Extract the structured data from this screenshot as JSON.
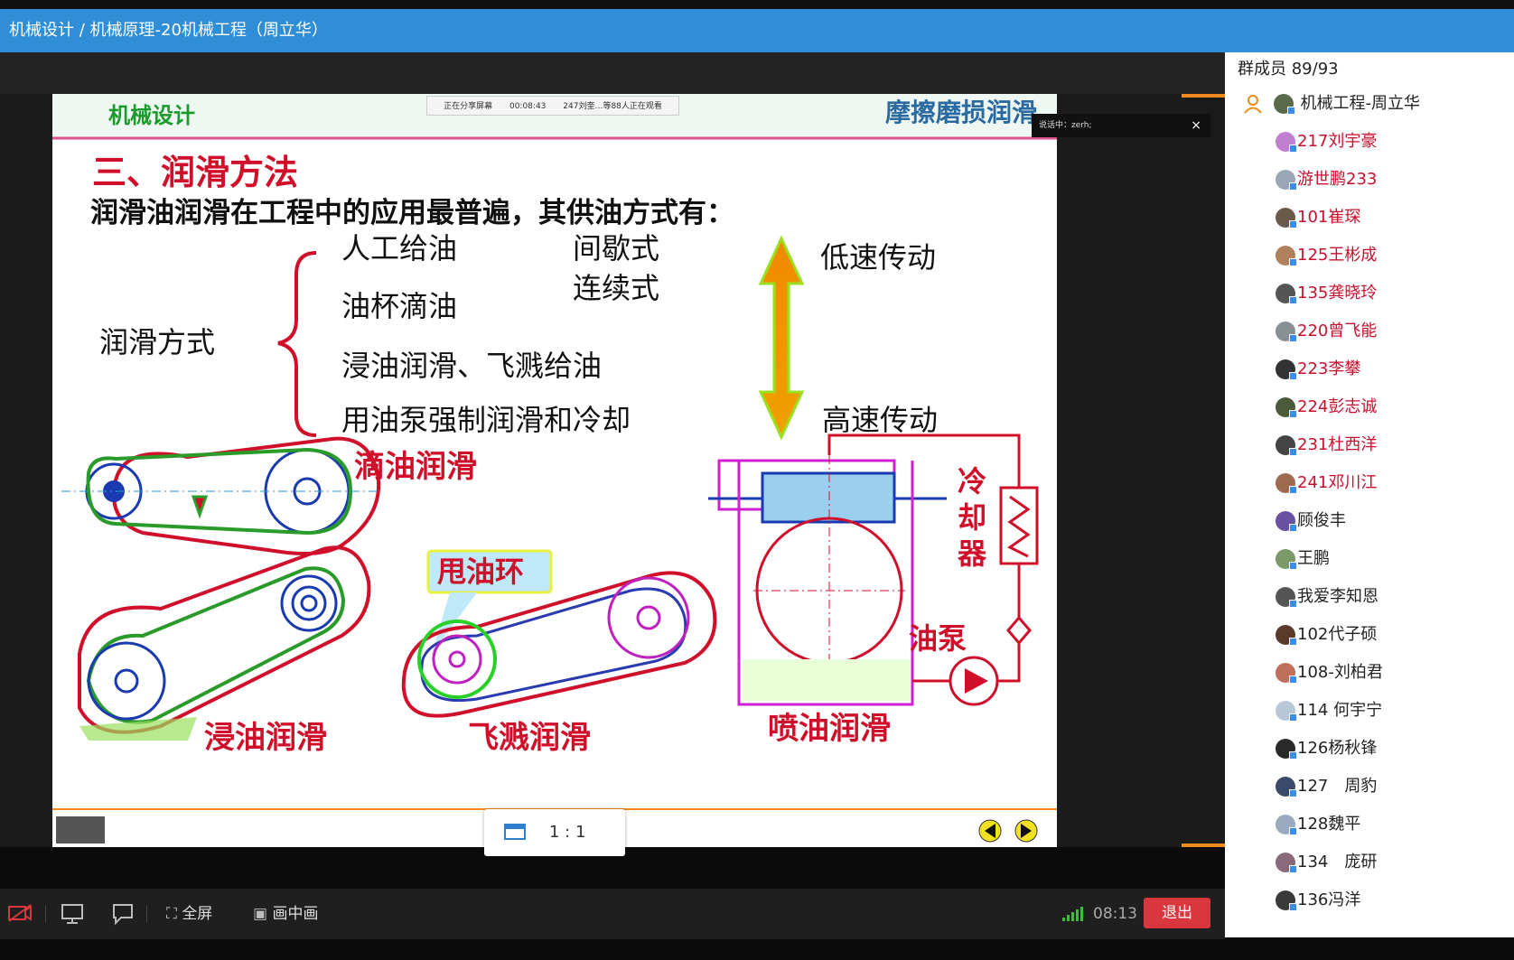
{
  "window": {
    "title": "机械设计 / 机械原理-20机械工程（周立华）"
  },
  "share_bar": {
    "status": "正在分享屏幕",
    "time": "00:08:43",
    "viewers": "247刘奎…等88人正在观看"
  },
  "subtitle_overlay": {
    "text": "说话中：zerh;",
    "close": "×"
  },
  "slide": {
    "course": "机械设计",
    "topic": "摩擦磨损润滑",
    "heading": "三、润滑方法",
    "intro": "润滑油润滑在工程中的应用最普遍，其供油方式有：",
    "method_label": "润滑方式",
    "methods": [
      "人工给油",
      "油杯滴油",
      "浸油润滑、飞溅给油",
      "用油泵强制润滑和冷却"
    ],
    "modes": [
      "间歇式",
      "连续式"
    ],
    "speed_low": "低速传动",
    "speed_high": "高速传动",
    "diagram_labels": {
      "drip": "滴油润滑",
      "ring": "甩油环",
      "dip": "浸油润滑",
      "splash": "飞溅润滑",
      "spray": "喷油润滑",
      "cooler": [
        "冷",
        "却",
        "器"
      ],
      "pump": "油泵"
    }
  },
  "zoom": {
    "label": "1 : 1"
  },
  "bottom_bar": {
    "fullscreen": "全屏",
    "pip": "画中画",
    "time": "08:13",
    "exit": "退出"
  },
  "members": {
    "header": "群成员 89/93",
    "owner": "机械工程-周立华",
    "list": [
      {
        "name": "217刘宇豪",
        "color": "red",
        "av": "#c07fd0"
      },
      {
        "name": "游世鹏233",
        "color": "red",
        "av": "#9aa6b8"
      },
      {
        "name": "101崔琛",
        "color": "red",
        "av": "#6b5a4a"
      },
      {
        "name": "125王彬成",
        "color": "red",
        "av": "#b0805a"
      },
      {
        "name": "135龚晓玲",
        "color": "red",
        "av": "#555"
      },
      {
        "name": "220曾飞能",
        "color": "red",
        "av": "#8a8f96"
      },
      {
        "name": "223李攀",
        "color": "red",
        "av": "#333"
      },
      {
        "name": "224彭志诚",
        "color": "red",
        "av": "#4a5a3a"
      },
      {
        "name": "231杜西洋",
        "color": "red",
        "av": "#444"
      },
      {
        "name": "241邓川江",
        "color": "red",
        "av": "#a06a50"
      },
      {
        "name": "顾俊丰",
        "color": "black",
        "av": "#6a50a0"
      },
      {
        "name": "王鹏",
        "color": "black",
        "av": "#7a9a6a"
      },
      {
        "name": "我爱李知恩",
        "color": "black",
        "av": "#555"
      },
      {
        "name": "102代子硕",
        "color": "black",
        "av": "#5a3a2a"
      },
      {
        "name": "108-刘柏君",
        "color": "black",
        "av": "#c0705a"
      },
      {
        "name": "114 何宇宁",
        "color": "black",
        "av": "#b8c8d8"
      },
      {
        "name": "126杨秋锋",
        "color": "black",
        "av": "#2a2a2a"
      },
      {
        "name": "127　周豹",
        "color": "black",
        "av": "#3a4a6a"
      },
      {
        "name": "128魏平",
        "color": "black",
        "av": "#9aaac0"
      },
      {
        "name": "134　庞研",
        "color": "black",
        "av": "#8a6a7a"
      },
      {
        "name": "136冯洋",
        "color": "black",
        "av": "#3a3a3a"
      }
    ]
  }
}
